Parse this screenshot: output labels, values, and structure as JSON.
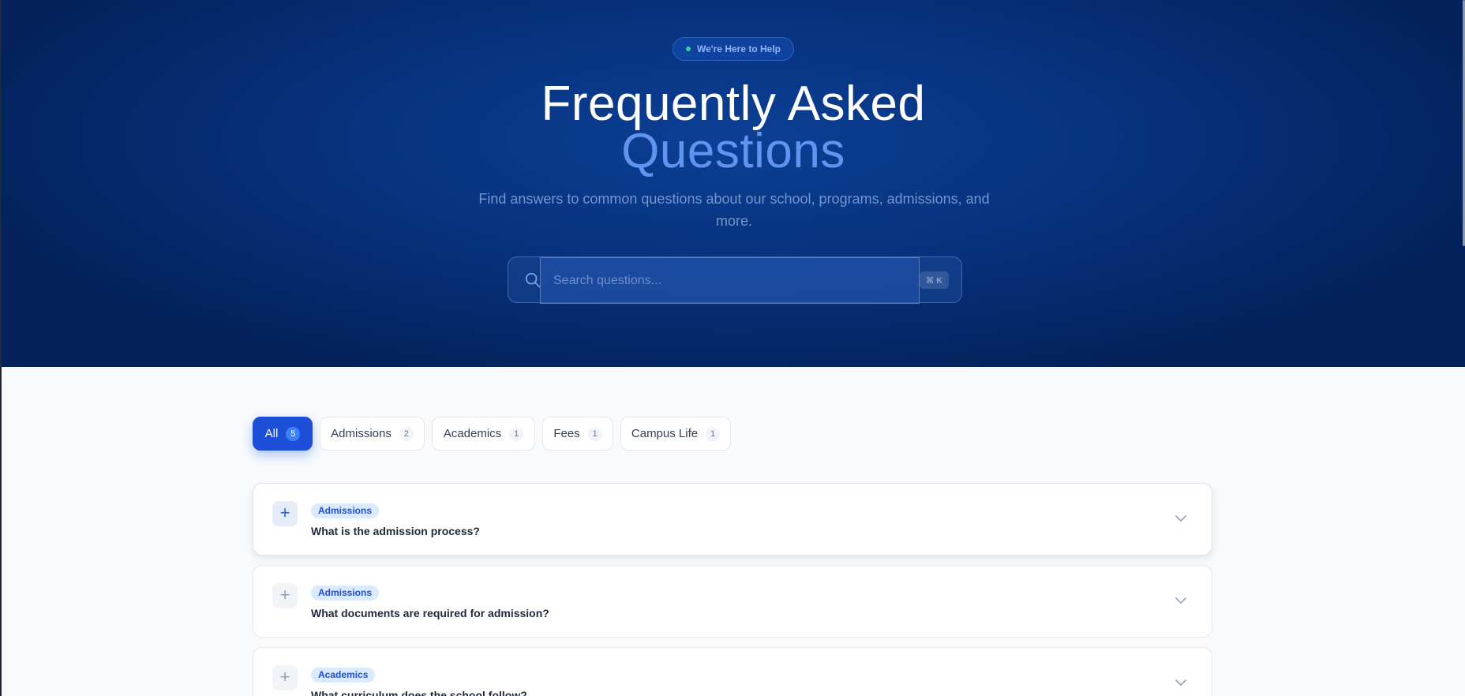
{
  "hero": {
    "badge_text": "We're Here to Help",
    "title_line1": "Frequently Asked",
    "title_line2": "Questions",
    "subtitle": "Find answers to common questions about our school, programs, admissions, and more.",
    "search_placeholder": "Search questions...",
    "shortcut_hint": "⌘ K",
    "colors": {
      "accent": "#5f95f0",
      "primary": "#1d4ed8",
      "badge_dot": "#34d399"
    }
  },
  "tabs": [
    {
      "label": "All",
      "count": "5",
      "active": true
    },
    {
      "label": "Admissions",
      "count": "2",
      "active": false
    },
    {
      "label": "Academics",
      "count": "1",
      "active": false
    },
    {
      "label": "Fees",
      "count": "1",
      "active": false
    },
    {
      "label": "Campus Life",
      "count": "1",
      "active": false
    }
  ],
  "faqs": [
    {
      "category": "Admissions",
      "question": "What is the admission process?",
      "expand_icon": "plus-icon",
      "toggle_icon": "chevron-down-icon"
    },
    {
      "category": "Admissions",
      "question": "What documents are required for admission?",
      "expand_icon": "plus-icon",
      "toggle_icon": "chevron-down-icon"
    },
    {
      "category": "Academics",
      "question": "What curriculum does the school follow?",
      "expand_icon": "plus-icon",
      "toggle_icon": "chevron-down-icon"
    }
  ]
}
